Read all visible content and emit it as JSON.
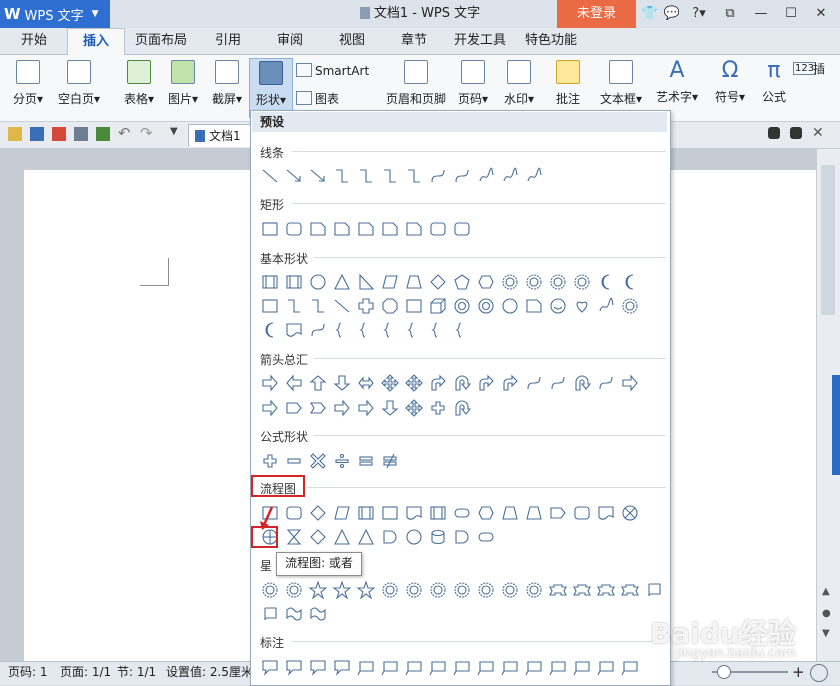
{
  "titlebar": {
    "app_logo": "W",
    "app_name": "WPS 文字",
    "doc_title": "文档1 - WPS 文字",
    "login": "未登录",
    "help": "?"
  },
  "menu_tabs": [
    "开始",
    "插入",
    "页面布局",
    "引用",
    "审阅",
    "视图",
    "章节",
    "开发工具",
    "特色功能"
  ],
  "active_tab": "插入",
  "ribbon": {
    "page_break": "分页",
    "blank_page": "空白页",
    "table": "表格",
    "picture": "图片",
    "screenshot": "截屏",
    "shape": "形状",
    "smartart": "SmartArt",
    "chart": "图表",
    "header_footer": "页眉和页脚",
    "page_number": "页码",
    "watermark": "水印",
    "comment": "批注",
    "textbox": "文本框",
    "wordart": "艺术字",
    "symbol": "符号",
    "formula": "公式",
    "insert": "插",
    "num_badge": "123"
  },
  "doc_tab": "文档1",
  "shape_panel": {
    "header": "预设",
    "sections": {
      "lines": "线条",
      "rect": "矩形",
      "basic": "基本形状",
      "arrows": "箭头总汇",
      "formula": "公式形状",
      "flowchart": "流程图",
      "stars": "星",
      "callouts": "标注"
    }
  },
  "tooltip": "流程图: 或者",
  "statusbar": {
    "page": "页码: 1",
    "pages": "页面: 1/1",
    "section": "节: 1/1",
    "setting": "设置值: 2.5厘米"
  },
  "watermark": {
    "main": "Baidu经验",
    "sub": "jingyan.baidu.com"
  },
  "colors": {
    "accent": "#2e6fd1",
    "login": "#e96a43",
    "highlight": "#d2252a",
    "shape_stroke": "#4a6f99"
  }
}
